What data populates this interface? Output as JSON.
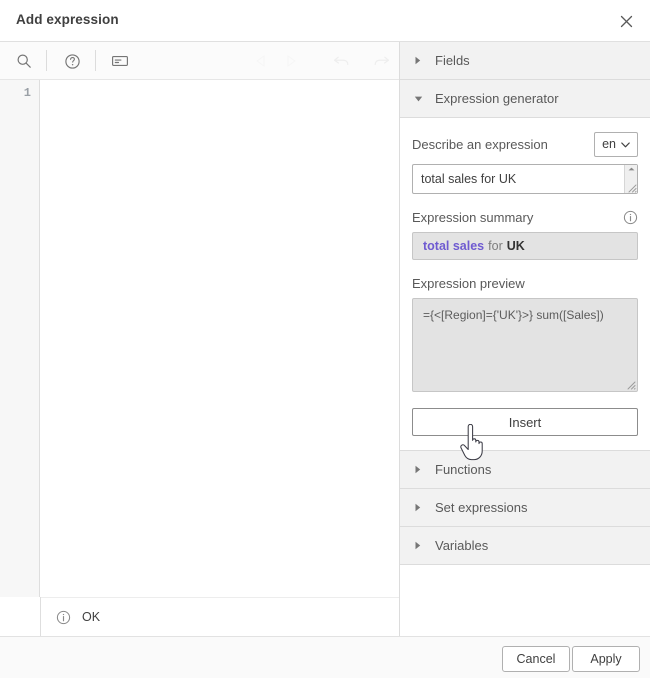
{
  "dialog": {
    "title": "Add expression",
    "close_icon": "close-icon"
  },
  "editor": {
    "toolbar": {
      "search_icon": "search-icon",
      "help_icon": "help-circle-icon",
      "comment_icon": "comment-box-icon",
      "undo_icon": "undo-arrow-icon",
      "redo_icon": "redo-arrow-icon"
    },
    "line_numbers": [
      "1"
    ],
    "code": "",
    "status": {
      "icon": "info-circle-icon",
      "text": "OK"
    }
  },
  "panel": {
    "sections": [
      {
        "label": "Fields",
        "expanded": false,
        "caret": "caret-right-icon"
      },
      {
        "label": "Expression generator",
        "expanded": true,
        "caret": "caret-down-icon"
      },
      {
        "label": "Functions",
        "expanded": false,
        "caret": "caret-right-icon"
      },
      {
        "label": "Set expressions",
        "expanded": false,
        "caret": "caret-right-icon"
      },
      {
        "label": "Variables",
        "expanded": false,
        "caret": "caret-right-icon"
      }
    ],
    "generator": {
      "describe_label": "Describe an expression",
      "language": "en",
      "language_caret": "chevron-down-icon",
      "describe_value": "total sales for UK",
      "describe_placeholder": "Describe an expression",
      "summary_label": "Expression summary",
      "summary_info_icon": "info-circle-icon",
      "summary_tokens": {
        "metric": "total sales",
        "connector": "for",
        "dimension": "UK"
      },
      "preview_label": "Expression preview",
      "preview_value": "={<[Region]={'UK'}>} sum([Sales])",
      "insert_label": "Insert"
    }
  },
  "footer": {
    "cancel_label": "Cancel",
    "apply_label": "Apply"
  },
  "colors": {
    "accent_purple": "#6f5bd1",
    "panel_header_bg": "#f2f2f2",
    "readonly_bg": "#e3e3e3",
    "text": "#404040"
  }
}
